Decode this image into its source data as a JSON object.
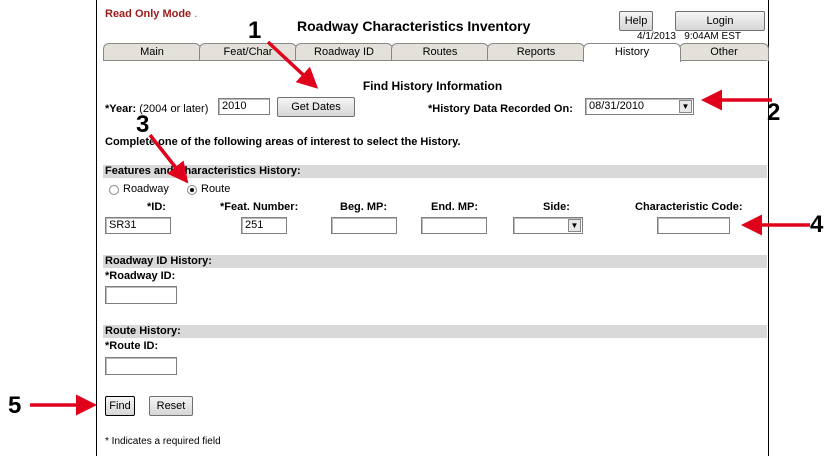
{
  "header": {
    "mode": "Read Only Mode",
    "mode_dot": ".",
    "title": "Roadway Characteristics Inventory",
    "help_label": "Help",
    "login_label": "Login",
    "date": "4/1/2013",
    "time": "9:04AM EST"
  },
  "tabs": [
    {
      "label": "Main"
    },
    {
      "label": "Feat/Char"
    },
    {
      "label": "Roadway ID"
    },
    {
      "label": "Routes"
    },
    {
      "label": "Reports"
    },
    {
      "label": "History"
    },
    {
      "label": "Other"
    }
  ],
  "page": {
    "title": "Find History Information",
    "year_label": "*Year:",
    "year_hint": "(2004 or later)",
    "year_value": "2010",
    "get_dates_label": "Get Dates",
    "history_recorded_label": "*History Data Recorded On:",
    "history_recorded_value": "08/31/2010",
    "instructions": "Complete one of the following areas of interest to select the History."
  },
  "features": {
    "section_title": "Features and Characteristics History:",
    "radio_roadway": "Roadway",
    "radio_route": "Route",
    "col_id": "*ID:",
    "col_feat_number": "*Feat. Number:",
    "col_beg_mp": "Beg. MP:",
    "col_end_mp": "End. MP:",
    "col_side": "Side:",
    "col_char_code": "Characteristic Code:",
    "id_value": "SR31",
    "feat_number_value": "251",
    "beg_mp_value": "",
    "end_mp_value": "",
    "side_value": "",
    "char_code_value": ""
  },
  "roadway_id_history": {
    "section_title": "Roadway ID History:",
    "field_label": "*Roadway ID:",
    "value": ""
  },
  "route_history": {
    "section_title": "Route History:",
    "field_label": "*Route ID:",
    "value": ""
  },
  "actions": {
    "find_label": "Find",
    "reset_label": "Reset"
  },
  "footnote": "* Indicates a required field",
  "callouts": [
    "1",
    "2",
    "3",
    "4",
    "5"
  ],
  "colors": {
    "callout_arrow": "#e0001b",
    "mode_text": "#9b1b1b",
    "section_bar": "#d9d9d9",
    "tab_bg": "#e3e1da"
  }
}
